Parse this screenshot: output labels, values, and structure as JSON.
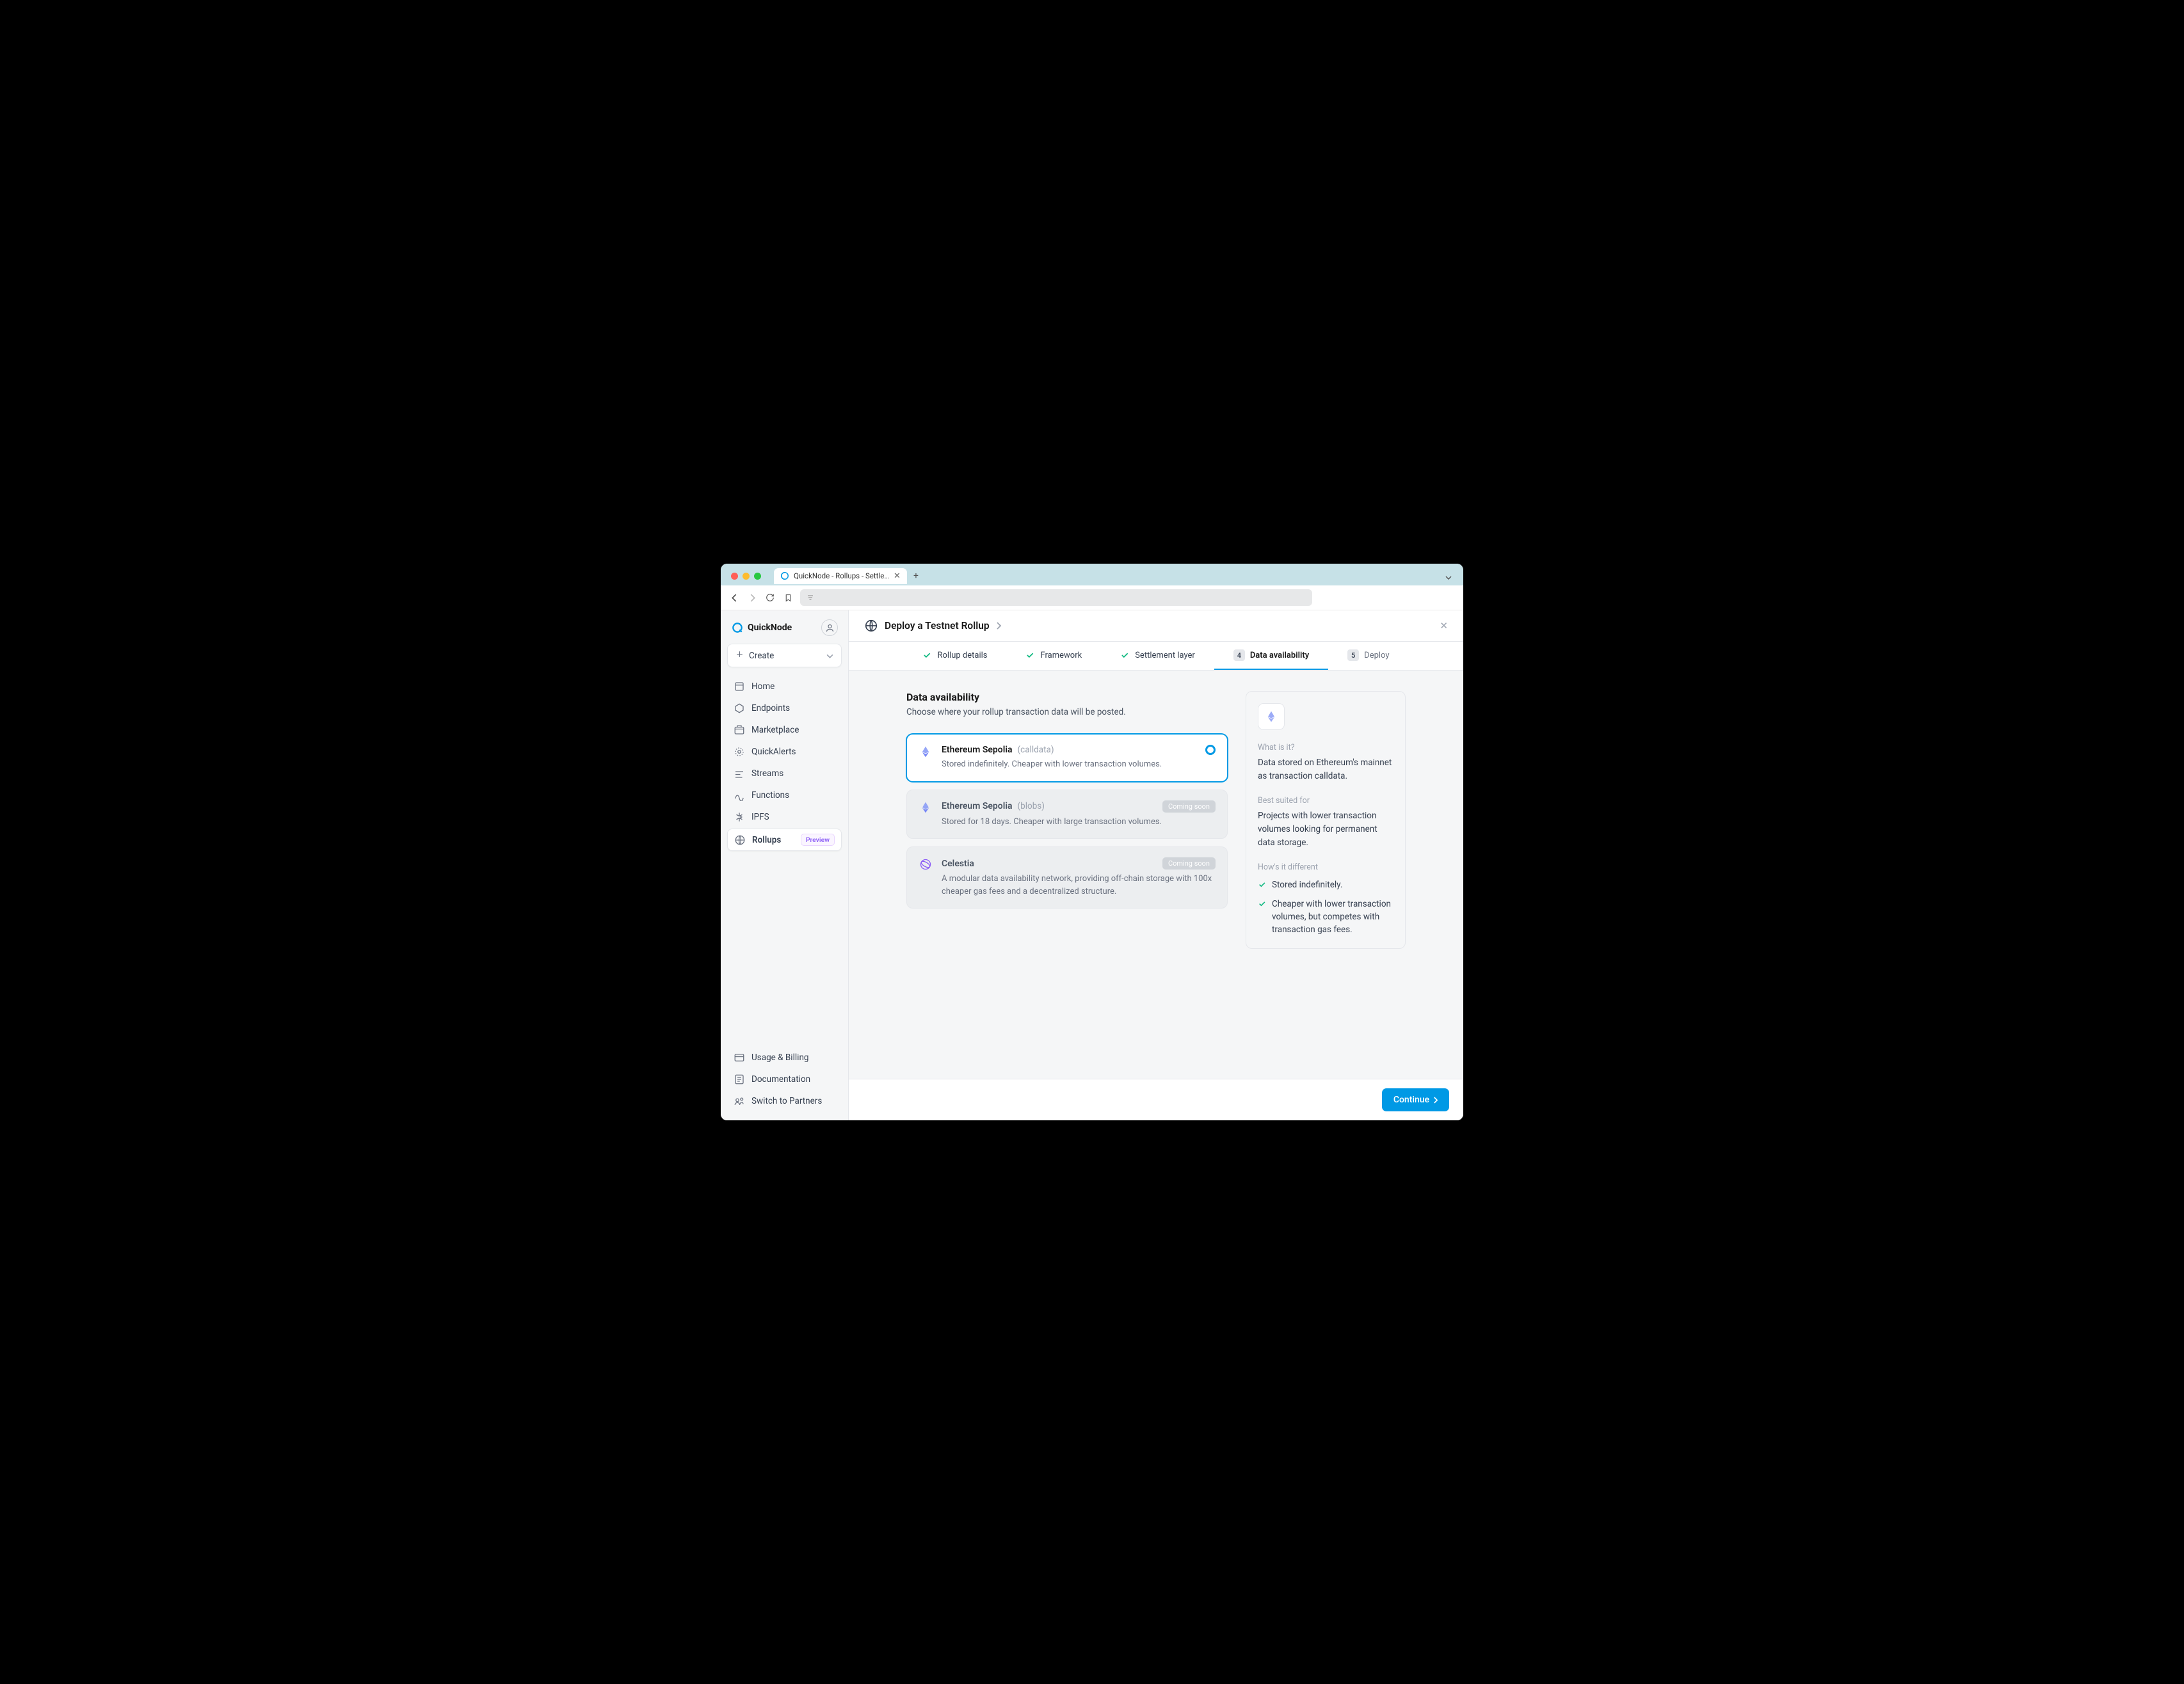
{
  "browser": {
    "tab_title": "QuickNode - Rollups - Settle…"
  },
  "brand": "QuickNode",
  "create_label": "Create",
  "nav": [
    {
      "label": "Home"
    },
    {
      "label": "Endpoints"
    },
    {
      "label": "Marketplace"
    },
    {
      "label": "QuickAlerts"
    },
    {
      "label": "Streams"
    },
    {
      "label": "Functions"
    },
    {
      "label": "IPFS"
    },
    {
      "label": "Rollups",
      "active": true,
      "badge": "Preview"
    }
  ],
  "footer_nav": [
    {
      "label": "Usage & Billing"
    },
    {
      "label": "Documentation"
    },
    {
      "label": "Switch to Partners"
    }
  ],
  "page": {
    "title": "Deploy a Testnet Rollup"
  },
  "steps": [
    {
      "label": "Rollup details",
      "state": "done"
    },
    {
      "label": "Framework",
      "state": "done"
    },
    {
      "label": "Settlement layer",
      "state": "done"
    },
    {
      "num": "4",
      "label": "Data availability",
      "state": "current"
    },
    {
      "num": "5",
      "label": "Deploy",
      "state": "upcoming"
    }
  ],
  "section": {
    "title": "Data availability",
    "desc": "Choose where your rollup transaction data will be posted."
  },
  "options": [
    {
      "name": "Ethereum Sepolia",
      "tag": "(calldata)",
      "desc": "Stored indefinitely. Cheaper with lower transaction volumes.",
      "selected": true,
      "icon": "eth"
    },
    {
      "name": "Ethereum Sepolia",
      "tag": "(blobs)",
      "desc": "Stored for 18 days. Cheaper with large transaction volumes.",
      "disabled": true,
      "badge": "Coming soon",
      "icon": "eth"
    },
    {
      "name": "Celestia",
      "desc": "A modular data availability network, providing off-chain storage with 100x cheaper gas fees and a decentralized structure.",
      "disabled": true,
      "badge": "Coming soon",
      "icon": "celestia"
    }
  ],
  "info": {
    "what_label": "What is it?",
    "what_text": "Data stored on Ethereum's mainnet as transaction calldata.",
    "suited_label": "Best suited for",
    "suited_text": "Projects with lower transaction volumes looking for permanent data storage.",
    "diff_label": "How's it different",
    "diff_items": [
      "Stored indefinitely.",
      "Cheaper with lower transaction volumes, but competes with transaction gas fees."
    ]
  },
  "continue_label": "Continue"
}
